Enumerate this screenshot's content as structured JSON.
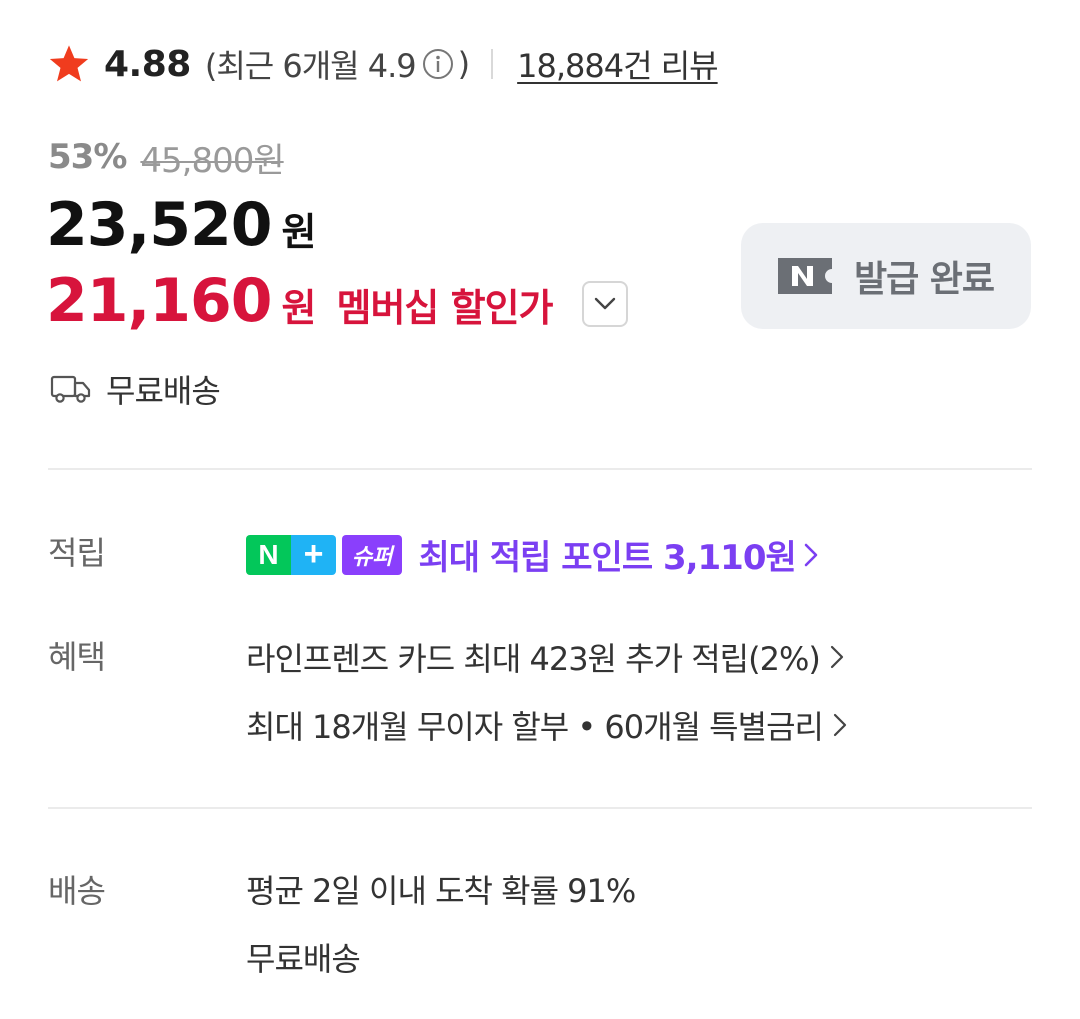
{
  "rating": {
    "score": "4.88",
    "recent": "(최근 6개월 4.9",
    "recent_close": ")",
    "reviews": "18,884건 리뷰"
  },
  "price": {
    "discount_rate": "53%",
    "original": "45,800원",
    "sale": "23,520",
    "sale_unit": "원",
    "member": "21,160",
    "member_unit": "원",
    "member_label": "멤버십 할인가"
  },
  "coupon": {
    "label": "발급 완료"
  },
  "shipping": {
    "free": "무료배송"
  },
  "points": {
    "label": "적립",
    "badge_n": "N",
    "badge_plus": "+",
    "badge_super": "슈퍼",
    "text": "최대 적립 포인트 3,110원"
  },
  "benefits": {
    "label": "혜택",
    "items": [
      "라인프렌즈 카드 최대 423원 추가 적립(2%)",
      "최대 18개월 무이자 할부 • 60개월 특별금리"
    ]
  },
  "delivery": {
    "label": "배송",
    "lines": [
      "평균 2일 이내 도착 확률 91%",
      "무료배송"
    ]
  },
  "colors": {
    "accent_red": "#d7143c",
    "star": "#f03c1e",
    "points_purple": "#7b3ff2",
    "naver_green": "#03c75a"
  },
  "icons": {
    "rating": "star-icon",
    "info": "info-icon",
    "toggle": "chevron-down-icon",
    "coupon": "naver-n-ticket-icon",
    "shipping": "truck-icon",
    "more": "chevron-right-icon"
  }
}
